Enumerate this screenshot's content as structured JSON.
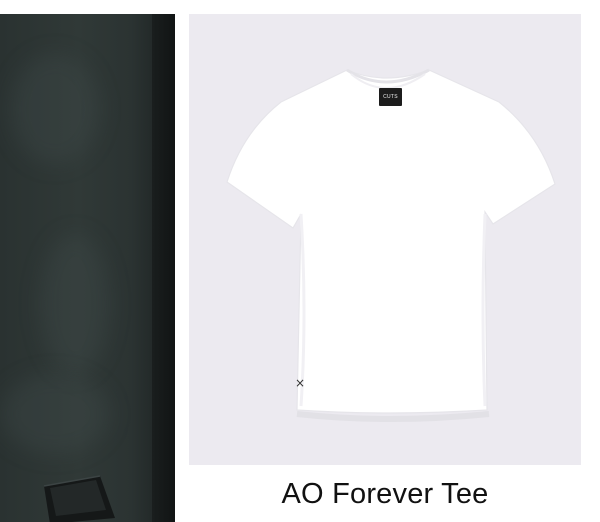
{
  "left_product": {
    "image_label": "product-image-partial"
  },
  "product": {
    "title": "AO Forever Tee",
    "brand_tag": "CUTS",
    "cross_mark": "×",
    "image_background": "#eceaf0"
  }
}
